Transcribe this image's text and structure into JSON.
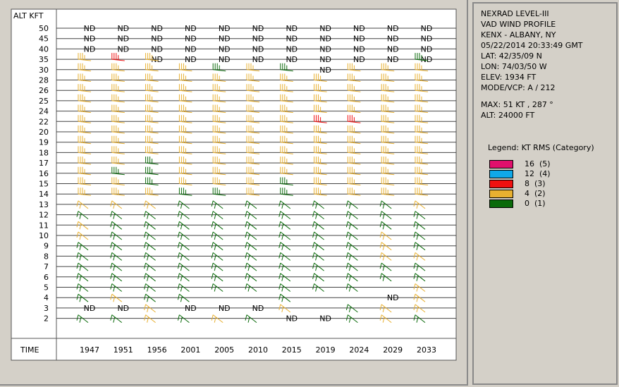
{
  "panel": {
    "product": "NEXRAD LEVEL-III",
    "profile": "VAD WIND PROFILE",
    "station": "KENX - ALBANY, NY",
    "datetime": "05/22/2014 20:33:49 GMT",
    "lat": "LAT: 42/35/09 N",
    "lon": "LON: 74/03/50 W",
    "elev": "ELEV: 1934 FT",
    "mode": "MODE/VCP: A / 212",
    "max": "MAX: 51 KT , 287 °",
    "alt": "ALT: 24000 FT",
    "legend_title": "Legend: KT RMS (Category)",
    "legend": [
      {
        "label": "16  (5)",
        "color": "#e0106c"
      },
      {
        "label": "12  (4)",
        "color": "#10a8e8"
      },
      {
        "label": "8  (3)",
        "color": "#f01010"
      },
      {
        "label": "4  (2)",
        "color": "#e8b030"
      },
      {
        "label": "0  (1)",
        "color": "#0a6a0a"
      }
    ]
  },
  "chart_data": {
    "type": "wind_profile",
    "ylabel": "ALT KFT",
    "xlabel": "TIME",
    "altitudes": [
      "50",
      "45",
      "40",
      "35",
      "30",
      "28",
      "26",
      "25",
      "24",
      "22",
      "20",
      "19",
      "18",
      "17",
      "16",
      "15",
      "14",
      "13",
      "12",
      "11",
      "10",
      "9",
      "8",
      "7",
      "6",
      "5",
      "4",
      "3",
      "2"
    ],
    "times": [
      "1947",
      "1951",
      "1956",
      "2001",
      "2005",
      "2010",
      "2015",
      "2019",
      "2024",
      "2029",
      "2033"
    ],
    "nd_label": "ND",
    "no_data": {
      "50": [
        0,
        1,
        2,
        3,
        4,
        5,
        6,
        7,
        8,
        9,
        10
      ],
      "45": [
        0,
        1,
        2,
        3,
        4,
        5,
        6,
        7,
        8,
        9,
        10
      ],
      "40": [
        0,
        1,
        2,
        3,
        4,
        5,
        6,
        7,
        8,
        9,
        10
      ],
      "35": [
        2,
        3,
        4,
        5,
        6,
        7,
        8,
        9,
        10
      ],
      "30": [
        7
      ],
      "4": [
        9
      ],
      "3": [
        0,
        1,
        3,
        4,
        5
      ],
      "2": [
        6,
        7
      ]
    },
    "category_colors": {
      "1": "#0a6a0a",
      "2": "#e8b030",
      "3": "#f01010",
      "4": "#10a8e8",
      "5": "#e0106c"
    },
    "columns": [
      {
        "time": "1947",
        "category": {
          "4": 1,
          "5": 1,
          "6": 1,
          "7": 1,
          "8": 1,
          "9": 1,
          "12": 1,
          "35": 2,
          "30": 2,
          "28": 2,
          "26": 2,
          "25": 2,
          "24": 2,
          "22": 2,
          "20": 2,
          "19": 2,
          "18": 2,
          "17": 2,
          "16": 2,
          "15": 2,
          "14": 2,
          "13": 2,
          "11": 2,
          "10": 2,
          "2": 1
        }
      },
      {
        "time": "1951",
        "category": {
          "4": 2,
          "5": 1,
          "6": 1,
          "7": 1,
          "8": 1,
          "9": 1,
          "10": 1,
          "11": 1,
          "12": 1,
          "16": 1,
          "35": 3,
          "30": 2,
          "28": 2,
          "26": 2,
          "25": 2,
          "24": 2,
          "22": 2,
          "20": 2,
          "19": 2,
          "18": 2,
          "17": 2,
          "15": 2,
          "14": 2,
          "13": 2,
          "2": 1
        }
      },
      {
        "time": "1956",
        "category": {
          "3": 2,
          "4": 1,
          "5": 1,
          "6": 1,
          "7": 1,
          "8": 1,
          "9": 1,
          "10": 1,
          "11": 1,
          "12": 1,
          "15": 1,
          "16": 1,
          "17": 1,
          "35": 2,
          "30": 2,
          "28": 2,
          "26": 2,
          "25": 2,
          "24": 2,
          "22": 2,
          "20": 2,
          "19": 2,
          "18": 2,
          "14": 2,
          "13": 2,
          "2": 2
        }
      },
      {
        "time": "2001",
        "category": {
          "4": 1,
          "5": 1,
          "6": 1,
          "7": 1,
          "8": 1,
          "9": 1,
          "10": 1,
          "11": 1,
          "12": 1,
          "13": 1,
          "14": 1,
          "30": 2,
          "28": 2,
          "26": 2,
          "25": 2,
          "24": 2,
          "22": 2,
          "20": 2,
          "19": 2,
          "18": 2,
          "17": 2,
          "16": 2,
          "15": 2,
          "2": 1
        }
      },
      {
        "time": "2005",
        "category": {
          "5": 1,
          "6": 1,
          "7": 1,
          "8": 1,
          "9": 1,
          "10": 1,
          "11": 1,
          "12": 1,
          "13": 1,
          "14": 1,
          "30": 1,
          "28": 2,
          "26": 2,
          "25": 2,
          "24": 2,
          "22": 2,
          "20": 2,
          "19": 2,
          "18": 2,
          "17": 2,
          "16": 2,
          "15": 2,
          "2": 2
        }
      },
      {
        "time": "2010",
        "category": {
          "5": 1,
          "6": 1,
          "7": 1,
          "8": 1,
          "9": 1,
          "10": 1,
          "11": 1,
          "12": 1,
          "13": 1,
          "30": 2,
          "28": 2,
          "26": 2,
          "25": 2,
          "24": 2,
          "22": 2,
          "20": 2,
          "19": 2,
          "18": 2,
          "17": 2,
          "16": 2,
          "15": 2,
          "14": 2,
          "2": 1
        }
      },
      {
        "time": "2015",
        "category": {
          "3": 2,
          "4": 1,
          "5": 1,
          "6": 1,
          "7": 1,
          "8": 1,
          "9": 1,
          "10": 1,
          "11": 1,
          "12": 1,
          "13": 1,
          "14": 1,
          "15": 1,
          "30": 1,
          "28": 2,
          "26": 2,
          "25": 2,
          "24": 2,
          "22": 2,
          "20": 2,
          "19": 2,
          "18": 2,
          "17": 2,
          "16": 2
        }
      },
      {
        "time": "2019",
        "category": {
          "5": 1,
          "6": 1,
          "7": 1,
          "8": 1,
          "9": 1,
          "10": 1,
          "11": 1,
          "12": 1,
          "13": 1,
          "22": 3,
          "28": 2,
          "26": 2,
          "25": 2,
          "24": 2,
          "20": 2,
          "19": 2,
          "18": 2,
          "17": 2,
          "16": 2,
          "15": 2,
          "14": 2
        }
      },
      {
        "time": "2024",
        "category": {
          "2": 1,
          "3": 1,
          "5": 1,
          "6": 1,
          "7": 1,
          "8": 1,
          "9": 1,
          "10": 1,
          "11": 1,
          "12": 1,
          "13": 1,
          "22": 3,
          "30": 2,
          "28": 2,
          "26": 2,
          "25": 2,
          "24": 2,
          "20": 2,
          "19": 2,
          "18": 2,
          "17": 2,
          "16": 2,
          "15": 2,
          "14": 2
        }
      },
      {
        "time": "2029",
        "category": {
          "2": 2,
          "3": 2,
          "6": 1,
          "7": 1,
          "8": 2,
          "9": 2,
          "10": 2,
          "11": 1,
          "12": 1,
          "13": 1,
          "30": 2,
          "28": 2,
          "26": 2,
          "25": 2,
          "24": 2,
          "22": 2,
          "20": 2,
          "19": 2,
          "18": 2,
          "17": 2,
          "16": 2,
          "15": 2,
          "14": 2
        }
      },
      {
        "time": "2033",
        "category": {
          "2": 1,
          "3": 2,
          "4": 2,
          "5": 2,
          "6": 1,
          "7": 1,
          "8": 2,
          "9": 1,
          "10": 1,
          "11": 1,
          "12": 1,
          "13": 2,
          "35": 1,
          "30": 2,
          "28": 2,
          "26": 2,
          "25": 2,
          "24": 2,
          "22": 2,
          "20": 2,
          "19": 2,
          "18": 2,
          "17": 2,
          "16": 2,
          "15": 2,
          "14": 2
        }
      }
    ]
  }
}
